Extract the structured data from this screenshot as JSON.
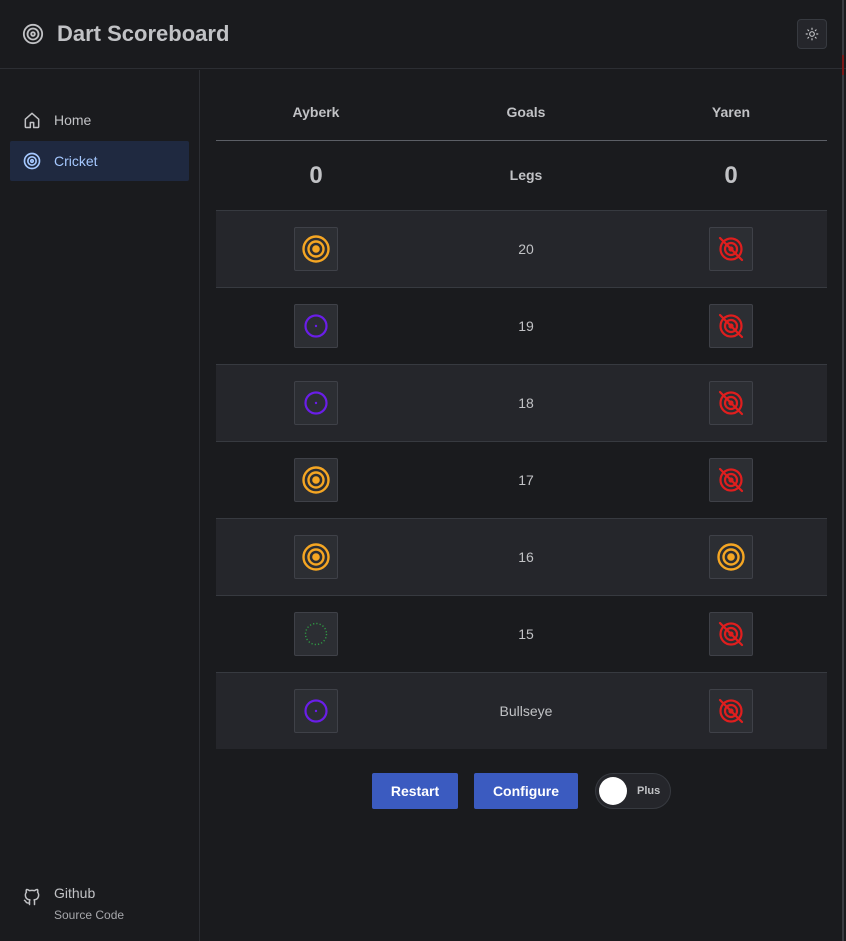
{
  "app": {
    "title": "Dart Scoreboard"
  },
  "sidebar": {
    "items": [
      {
        "label": "Home",
        "icon": "home-icon",
        "active": false
      },
      {
        "label": "Cricket",
        "icon": "target-icon",
        "active": true
      }
    ],
    "footer": {
      "label": "Github",
      "sublabel": "Source Code",
      "icon": "github-icon"
    }
  },
  "scoreboard": {
    "player_left": "Ayberk",
    "goals_header": "Goals",
    "player_right": "Yaren",
    "legs_label": "Legs",
    "legs_left": "0",
    "legs_right": "0",
    "rows": [
      {
        "label": "20",
        "left": "closed",
        "right": "blocked"
      },
      {
        "label": "19",
        "left": "single",
        "right": "blocked"
      },
      {
        "label": "18",
        "left": "single",
        "right": "blocked"
      },
      {
        "label": "17",
        "left": "closed",
        "right": "blocked"
      },
      {
        "label": "16",
        "left": "closed",
        "right": "closed"
      },
      {
        "label": "15",
        "left": "empty",
        "right": "blocked"
      },
      {
        "label": "Bullseye",
        "left": "single",
        "right": "blocked"
      }
    ]
  },
  "controls": {
    "restart_label": "Restart",
    "configure_label": "Configure",
    "toggle_label": "Plus",
    "toggle_on": false
  },
  "colors": {
    "closed": "#f5a623",
    "single": "#6a1ee8",
    "empty": "#2f9e44",
    "blocked": "#e01e1e",
    "accent": "#3b5bc0"
  }
}
